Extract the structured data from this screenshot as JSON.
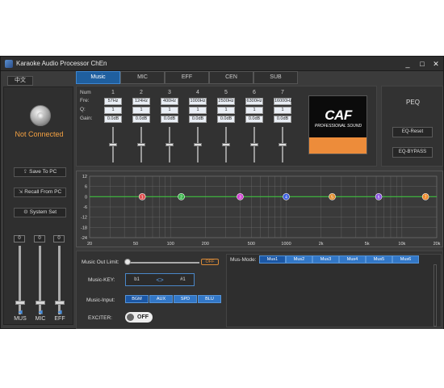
{
  "window": {
    "title": "Karaoke Audio Processor ChEn",
    "min": "_",
    "max": "□",
    "close": "✕"
  },
  "lang_button": "中文",
  "tabs": [
    {
      "label": "Music",
      "active": true
    },
    {
      "label": "MIC",
      "active": false
    },
    {
      "label": "EFF",
      "active": false
    },
    {
      "label": "CEN",
      "active": false
    },
    {
      "label": "SUB",
      "active": false
    }
  ],
  "left": {
    "status": "Not Connected",
    "save": "Save To PC",
    "recall": "Recall From PC",
    "system": "System Set",
    "faders": [
      {
        "label": "MUS",
        "value": "0"
      },
      {
        "label": "MIC",
        "value": "0"
      },
      {
        "label": "EFF",
        "value": "0"
      }
    ]
  },
  "eq": {
    "row_labels": {
      "num": "Num",
      "fre": "Fre:",
      "q": "Q:",
      "gain": "Gain:"
    },
    "bands": [
      {
        "num": "1",
        "fre": "57Hz",
        "q": "1",
        "gain": "0.0dB"
      },
      {
        "num": "2",
        "fre": "124Hz",
        "q": "1",
        "gain": "0.0dB"
      },
      {
        "num": "3",
        "fre": "400Hz",
        "q": "1",
        "gain": "0.0dB"
      },
      {
        "num": "4",
        "fre": "1000Hz",
        "q": "1",
        "gain": "0.0dB"
      },
      {
        "num": "5",
        "fre": "2500Hz",
        "q": "1",
        "gain": "0.0dB"
      },
      {
        "num": "6",
        "fre": "6300Hz",
        "q": "1",
        "gain": "0.0dB"
      },
      {
        "num": "7",
        "fre": "16000Hz",
        "q": "1",
        "gain": "0.0dB"
      }
    ]
  },
  "logo": {
    "text": "CAF",
    "sub": "PROFESSIONAL SOUND"
  },
  "peq": {
    "title": "PEQ",
    "reset": "EQ-Reset",
    "bypass": "EQ-BYPASS"
  },
  "graph": {
    "y_ticks": [
      "12",
      "6",
      "0",
      "-6",
      "-12",
      "-18",
      "-24"
    ],
    "x_ticks": [
      "20",
      "50",
      "100",
      "200",
      "500",
      "1000",
      "2k",
      "5k",
      "10k",
      "20k"
    ],
    "nodes": [
      {
        "label": "1",
        "color": "#e05050"
      },
      {
        "label": "2",
        "color": "#39b54a"
      },
      {
        "label": "3",
        "color": "#d13fd1"
      },
      {
        "label": "4",
        "color": "#3d5fe0"
      },
      {
        "label": "5",
        "color": "#e08a2a"
      },
      {
        "label": "6",
        "color": "#8a52e0"
      },
      {
        "label": "7",
        "color": "#ef8b2c"
      }
    ],
    "curve_color": "#3fbf3f"
  },
  "bottom": {
    "music_out_limit": "Music Out Limit:",
    "limit_toggle": "OFF",
    "music_key": "Music-KEY:",
    "key_left": "b1",
    "key_center": "<>",
    "key_right": "#1",
    "music_input": "Music-Input:",
    "inputs": [
      "BGM",
      "AUX",
      "SPD",
      "BLU"
    ],
    "exciter": "EXCITER:",
    "exciter_state": "OFF",
    "mus_mode": "Mus-Mode:",
    "modes": [
      "Mus1",
      "Mus2",
      "Mus3",
      "Mus4",
      "Mus5",
      "Mus6"
    ]
  }
}
